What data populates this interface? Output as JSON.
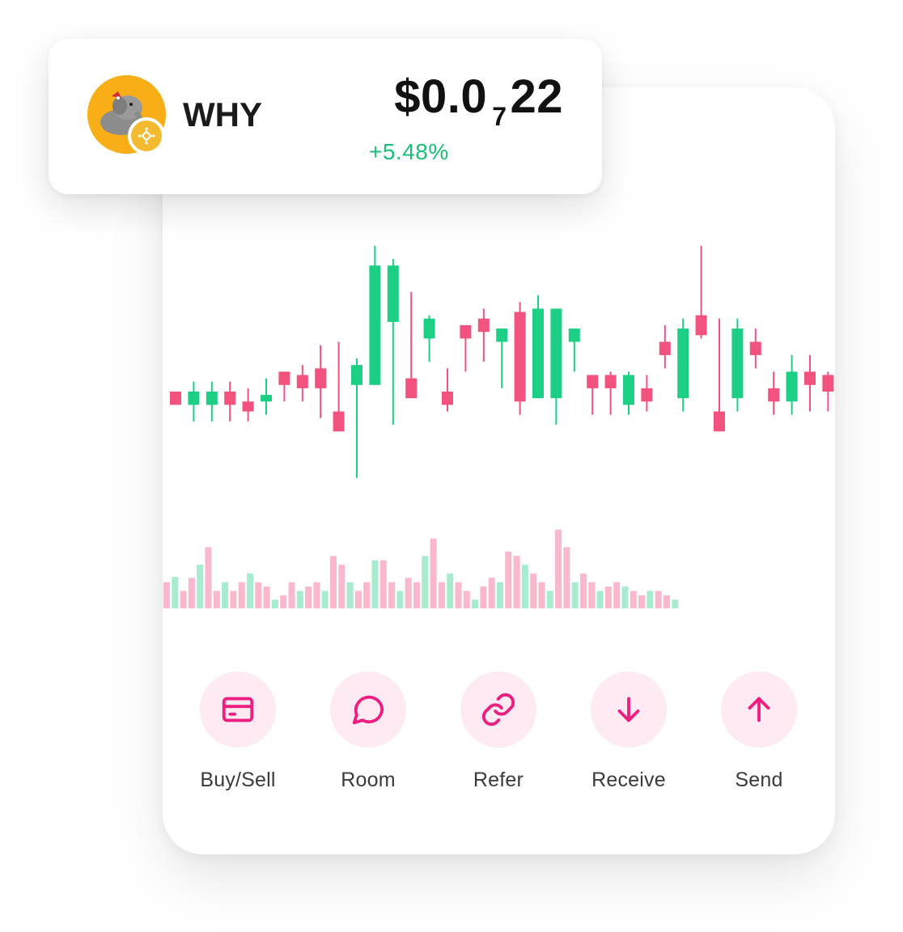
{
  "token": {
    "symbol": "WHY",
    "price_prefix": "$0.0",
    "price_zero_count": "7",
    "price_digits": "22",
    "change": "+5.48%",
    "change_color": "#1bbf77",
    "avatar_icon": "elephant-mascot-icon",
    "chain_icon": "bnb-chain-icon",
    "avatar_color": "#f7ae17",
    "chain_color": "#f3ba2f"
  },
  "chart_data": {
    "type": "candlestick",
    "up_color": "#1ccf85",
    "down_color": "#f2527e",
    "volume_up_color": "#a8ebcf",
    "volume_down_color": "#f9b8cc",
    "y_range": [
      0,
      100
    ],
    "candles": [
      {
        "o": 36,
        "c": 40,
        "h": 40,
        "l": 36,
        "up": false
      },
      {
        "o": 36,
        "c": 40,
        "h": 43,
        "l": 31,
        "up": true
      },
      {
        "o": 36,
        "c": 40,
        "h": 43,
        "l": 31,
        "up": true
      },
      {
        "o": 40,
        "c": 36,
        "h": 43,
        "l": 31,
        "up": false
      },
      {
        "o": 37,
        "c": 34,
        "h": 41,
        "l": 31,
        "up": false
      },
      {
        "o": 37,
        "c": 39,
        "h": 44,
        "l": 33,
        "up": true
      },
      {
        "o": 46,
        "c": 42,
        "h": 46,
        "l": 37,
        "up": false
      },
      {
        "o": 45,
        "c": 41,
        "h": 48,
        "l": 37,
        "up": false
      },
      {
        "o": 47,
        "c": 41,
        "h": 54,
        "l": 32,
        "up": false
      },
      {
        "o": 34,
        "c": 28,
        "h": 55,
        "l": 28,
        "up": false
      },
      {
        "o": 42,
        "c": 48,
        "h": 50,
        "l": 14,
        "up": true
      },
      {
        "o": 42,
        "c": 78,
        "h": 84,
        "l": 42,
        "up": true
      },
      {
        "o": 61,
        "c": 78,
        "h": 80,
        "l": 30,
        "up": true
      },
      {
        "o": 44,
        "c": 38,
        "h": 70,
        "l": 38,
        "up": false
      },
      {
        "o": 56,
        "c": 62,
        "h": 63,
        "l": 49,
        "up": true
      },
      {
        "o": 40,
        "c": 36,
        "h": 47,
        "l": 34,
        "up": false
      },
      {
        "o": 60,
        "c": 56,
        "h": 60,
        "l": 46,
        "up": false
      },
      {
        "o": 62,
        "c": 58,
        "h": 65,
        "l": 49,
        "up": false
      },
      {
        "o": 55,
        "c": 59,
        "h": 59,
        "l": 41,
        "up": true
      },
      {
        "o": 64,
        "c": 37,
        "h": 67,
        "l": 33,
        "up": false
      },
      {
        "o": 38,
        "c": 65,
        "h": 69,
        "l": 38,
        "up": true
      },
      {
        "o": 38,
        "c": 65,
        "h": 65,
        "l": 30,
        "up": true
      },
      {
        "o": 55,
        "c": 59,
        "h": 59,
        "l": 46,
        "up": true
      },
      {
        "o": 45,
        "c": 41,
        "h": 45,
        "l": 33,
        "up": false
      },
      {
        "o": 45,
        "c": 41,
        "h": 46,
        "l": 33,
        "up": false
      },
      {
        "o": 36,
        "c": 45,
        "h": 46,
        "l": 33,
        "up": true
      },
      {
        "o": 41,
        "c": 37,
        "h": 45,
        "l": 34,
        "up": false
      },
      {
        "o": 55,
        "c": 51,
        "h": 60,
        "l": 47,
        "up": false
      },
      {
        "o": 38,
        "c": 59,
        "h": 62,
        "l": 34,
        "up": true
      },
      {
        "o": 63,
        "c": 57,
        "h": 84,
        "l": 56,
        "up": false
      },
      {
        "o": 34,
        "c": 28,
        "h": 62,
        "l": 28,
        "up": false
      },
      {
        "o": 38,
        "c": 59,
        "h": 62,
        "l": 34,
        "up": true
      },
      {
        "o": 55,
        "c": 51,
        "h": 59,
        "l": 47,
        "up": false
      },
      {
        "o": 41,
        "c": 37,
        "h": 46,
        "l": 33,
        "up": false
      },
      {
        "o": 37,
        "c": 46,
        "h": 51,
        "l": 33,
        "up": true
      },
      {
        "o": 46,
        "c": 42,
        "h": 51,
        "l": 34,
        "up": false
      },
      {
        "o": 45,
        "c": 40,
        "h": 46,
        "l": 34,
        "up": false
      },
      {
        "o": 55,
        "c": 59,
        "h": 63,
        "l": 51,
        "up": true
      },
      {
        "o": 55,
        "c": 85,
        "h": 85,
        "l": 55,
        "up": true
      }
    ],
    "volumes_pct": [
      30,
      36,
      20,
      35,
      50,
      70,
      20,
      30,
      20,
      30,
      40,
      30,
      25,
      10,
      15,
      30,
      20,
      25,
      30,
      20,
      60,
      50,
      30,
      20,
      30,
      55,
      55,
      30,
      20,
      35,
      30,
      60,
      80,
      30,
      40,
      30,
      20,
      10,
      25,
      35,
      30,
      65,
      60,
      50,
      40,
      30,
      20,
      90,
      70,
      30,
      40,
      30,
      20,
      25,
      30,
      25,
      20,
      15,
      20,
      20,
      15,
      10
    ]
  },
  "actions": [
    {
      "label": "Buy/Sell",
      "icon": "card-icon"
    },
    {
      "label": "Room",
      "icon": "chat-bubble-icon"
    },
    {
      "label": "Refer",
      "icon": "link-icon"
    },
    {
      "label": "Receive",
      "icon": "arrow-down-icon"
    },
    {
      "label": "Send",
      "icon": "arrow-up-icon"
    }
  ],
  "accent_color": "#ec1f80",
  "action_bg_color": "#fdeaf3"
}
